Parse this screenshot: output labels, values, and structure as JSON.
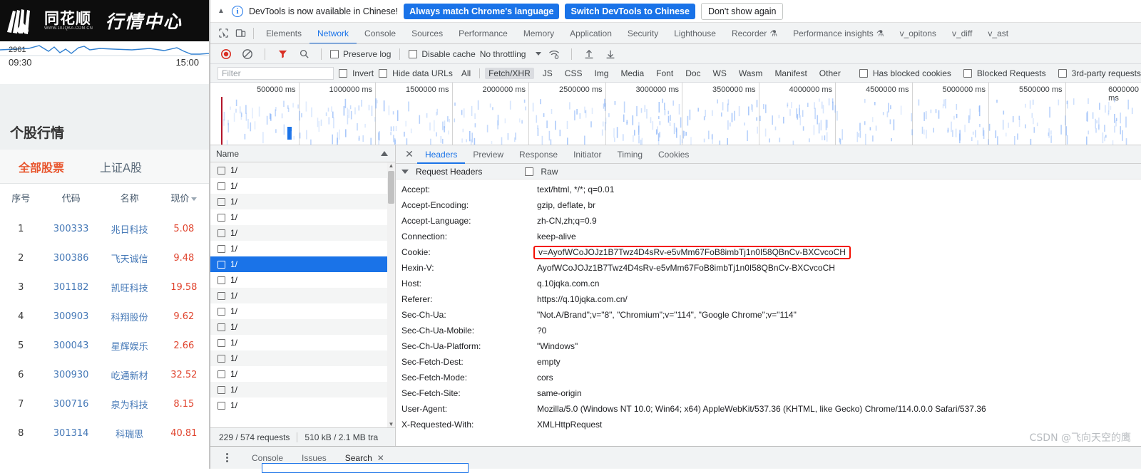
{
  "webpage": {
    "logo": {
      "brand_cn": "同花顺",
      "url": "WWW.10JQKA.COM.CN",
      "slogan": "行情中心"
    },
    "mini_chart": {
      "index_value": "2961",
      "time_start": "09:30",
      "time_end": "15:00"
    },
    "section_title": "个股行情",
    "tabs": [
      {
        "label": "全部股票",
        "active": true
      },
      {
        "label": "上证A股",
        "active": false
      }
    ],
    "table": {
      "headers": [
        "序号",
        "代码",
        "名称",
        "现价"
      ],
      "rows": [
        {
          "no": "1",
          "code": "300333",
          "name": "兆日科技",
          "price": "5.08"
        },
        {
          "no": "2",
          "code": "300386",
          "name": "飞天诚信",
          "price": "9.48"
        },
        {
          "no": "3",
          "code": "301182",
          "name": "凯旺科技",
          "price": "19.58"
        },
        {
          "no": "4",
          "code": "300903",
          "name": "科翔股份",
          "price": "9.62"
        },
        {
          "no": "5",
          "code": "300043",
          "name": "星辉娱乐",
          "price": "2.66"
        },
        {
          "no": "6",
          "code": "300930",
          "name": "屹通新材",
          "price": "32.52"
        },
        {
          "no": "7",
          "code": "300716",
          "name": "泉为科技",
          "price": "8.15"
        },
        {
          "no": "8",
          "code": "301314",
          "name": "科瑞思",
          "price": "40.81"
        }
      ]
    }
  },
  "devtools": {
    "infobar": {
      "message": "DevTools is now available in Chinese!",
      "btn_always": "Always match Chrome's language",
      "btn_switch": "Switch DevTools to Chinese",
      "btn_dismiss": "Don't show again"
    },
    "main_tabs": [
      {
        "label": "Elements",
        "selected": false,
        "flask": false
      },
      {
        "label": "Network",
        "selected": true,
        "flask": false
      },
      {
        "label": "Console",
        "selected": false,
        "flask": false
      },
      {
        "label": "Sources",
        "selected": false,
        "flask": false
      },
      {
        "label": "Performance",
        "selected": false,
        "flask": false
      },
      {
        "label": "Memory",
        "selected": false,
        "flask": false
      },
      {
        "label": "Application",
        "selected": false,
        "flask": false
      },
      {
        "label": "Security",
        "selected": false,
        "flask": false
      },
      {
        "label": "Lighthouse",
        "selected": false,
        "flask": false
      },
      {
        "label": "Recorder",
        "selected": false,
        "flask": true
      },
      {
        "label": "Performance insights",
        "selected": false,
        "flask": true
      },
      {
        "label": "v_opitons",
        "selected": false,
        "flask": false
      },
      {
        "label": "v_diff",
        "selected": false,
        "flask": false
      },
      {
        "label": "v_ast",
        "selected": false,
        "flask": false
      }
    ],
    "network_toolbar": {
      "preserve_log": "Preserve log",
      "disable_cache": "Disable cache",
      "throttling": "No throttling"
    },
    "filter_bar": {
      "filter_placeholder": "Filter",
      "invert": "Invert",
      "hide_data_urls": "Hide data URLs",
      "types": [
        {
          "label": "All",
          "on": false
        },
        {
          "label": "Fetch/XHR",
          "on": true
        },
        {
          "label": "JS",
          "on": false
        },
        {
          "label": "CSS",
          "on": false
        },
        {
          "label": "Img",
          "on": false
        },
        {
          "label": "Media",
          "on": false
        },
        {
          "label": "Font",
          "on": false
        },
        {
          "label": "Doc",
          "on": false
        },
        {
          "label": "WS",
          "on": false
        },
        {
          "label": "Wasm",
          "on": false
        },
        {
          "label": "Manifest",
          "on": false
        },
        {
          "label": "Other",
          "on": false
        }
      ],
      "has_blocked_cookies": "Has blocked cookies",
      "blocked_requests": "Blocked Requests",
      "third_party": "3rd-party requests"
    },
    "overview": {
      "ticks": [
        "500000 ms",
        "1000000 ms",
        "1500000 ms",
        "2000000 ms",
        "2500000 ms",
        "3000000 ms",
        "3500000 ms",
        "4000000 ms",
        "4500000 ms",
        "5000000 ms",
        "5500000 ms",
        "6000000 ms"
      ]
    },
    "request_panel": {
      "column_name": "Name",
      "rows": [
        {
          "label": "1/",
          "selected": false
        },
        {
          "label": "1/",
          "selected": false
        },
        {
          "label": "1/",
          "selected": false
        },
        {
          "label": "1/",
          "selected": false
        },
        {
          "label": "1/",
          "selected": false
        },
        {
          "label": "1/",
          "selected": false
        },
        {
          "label": "1/",
          "selected": true
        },
        {
          "label": "1/",
          "selected": false
        },
        {
          "label": "1/",
          "selected": false
        },
        {
          "label": "1/",
          "selected": false
        },
        {
          "label": "1/",
          "selected": false
        },
        {
          "label": "1/",
          "selected": false
        },
        {
          "label": "1/",
          "selected": false
        },
        {
          "label": "1/",
          "selected": false
        },
        {
          "label": "1/",
          "selected": false
        },
        {
          "label": "1/",
          "selected": false
        }
      ],
      "status_requests": "229 / 574 requests",
      "status_transferred": "510 kB / 2.1 MB tra"
    },
    "detail_panel": {
      "tabs": [
        {
          "label": "Headers",
          "selected": true
        },
        {
          "label": "Preview",
          "selected": false
        },
        {
          "label": "Response",
          "selected": false
        },
        {
          "label": "Initiator",
          "selected": false
        },
        {
          "label": "Timing",
          "selected": false
        },
        {
          "label": "Cookies",
          "selected": false
        }
      ],
      "section_title": "Request Headers",
      "raw_label": "Raw",
      "headers": [
        {
          "key": "Accept:",
          "value": "text/html, */*; q=0.01",
          "highlight": false
        },
        {
          "key": "Accept-Encoding:",
          "value": "gzip, deflate, br",
          "highlight": false
        },
        {
          "key": "Accept-Language:",
          "value": "zh-CN,zh;q=0.9",
          "highlight": false
        },
        {
          "key": "Connection:",
          "value": "keep-alive",
          "highlight": false
        },
        {
          "key": "Cookie:",
          "value": "v=AyofWCoJOJz1B7Twz4D4sRv-e5vMm67FoB8imbTj1n0I58QBnCv-BXCvcoCH",
          "highlight": true
        },
        {
          "key": "Hexin-V:",
          "value": "AyofWCoJOJz1B7Twz4D4sRv-e5vMm67FoB8imbTj1n0I58QBnCv-BXCvcoCH",
          "highlight": false
        },
        {
          "key": "Host:",
          "value": "q.10jqka.com.cn",
          "highlight": false
        },
        {
          "key": "Referer:",
          "value": "https://q.10jqka.com.cn/",
          "highlight": false
        },
        {
          "key": "Sec-Ch-Ua:",
          "value": "\"Not.A/Brand\";v=\"8\", \"Chromium\";v=\"114\", \"Google Chrome\";v=\"114\"",
          "highlight": false
        },
        {
          "key": "Sec-Ch-Ua-Mobile:",
          "value": "?0",
          "highlight": false
        },
        {
          "key": "Sec-Ch-Ua-Platform:",
          "value": "\"Windows\"",
          "highlight": false
        },
        {
          "key": "Sec-Fetch-Dest:",
          "value": "empty",
          "highlight": false
        },
        {
          "key": "Sec-Fetch-Mode:",
          "value": "cors",
          "highlight": false
        },
        {
          "key": "Sec-Fetch-Site:",
          "value": "same-origin",
          "highlight": false
        },
        {
          "key": "User-Agent:",
          "value": "Mozilla/5.0 (Windows NT 10.0; Win64; x64) AppleWebKit/537.36 (KHTML, like Gecko) Chrome/114.0.0.0 Safari/537.36",
          "highlight": false
        },
        {
          "key": "X-Requested-With:",
          "value": "XMLHttpRequest",
          "highlight": false
        }
      ]
    },
    "drawer": {
      "tabs": [
        {
          "label": "Console",
          "selected": false
        },
        {
          "label": "Issues",
          "selected": false
        },
        {
          "label": "Search",
          "selected": true
        }
      ],
      "close_glyph": "✕"
    },
    "watermark": "CSDN @飞向天空的鹰"
  }
}
